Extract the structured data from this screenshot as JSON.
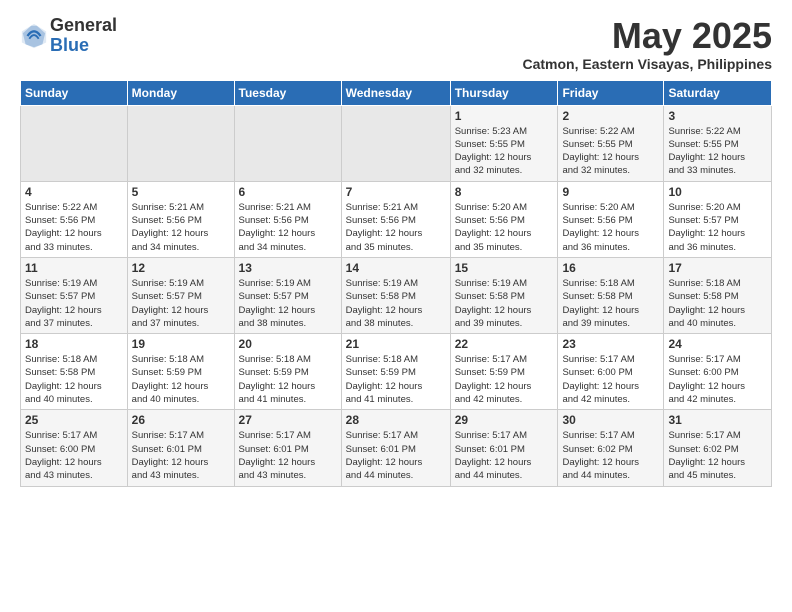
{
  "logo": {
    "general": "General",
    "blue": "Blue"
  },
  "title": "May 2025",
  "location": "Catmon, Eastern Visayas, Philippines",
  "days_of_week": [
    "Sunday",
    "Monday",
    "Tuesday",
    "Wednesday",
    "Thursday",
    "Friday",
    "Saturday"
  ],
  "weeks": [
    [
      {
        "day": "",
        "info": ""
      },
      {
        "day": "",
        "info": ""
      },
      {
        "day": "",
        "info": ""
      },
      {
        "day": "",
        "info": ""
      },
      {
        "day": "1",
        "info": "Sunrise: 5:23 AM\nSunset: 5:55 PM\nDaylight: 12 hours\nand 32 minutes."
      },
      {
        "day": "2",
        "info": "Sunrise: 5:22 AM\nSunset: 5:55 PM\nDaylight: 12 hours\nand 32 minutes."
      },
      {
        "day": "3",
        "info": "Sunrise: 5:22 AM\nSunset: 5:55 PM\nDaylight: 12 hours\nand 33 minutes."
      }
    ],
    [
      {
        "day": "4",
        "info": "Sunrise: 5:22 AM\nSunset: 5:56 PM\nDaylight: 12 hours\nand 33 minutes."
      },
      {
        "day": "5",
        "info": "Sunrise: 5:21 AM\nSunset: 5:56 PM\nDaylight: 12 hours\nand 34 minutes."
      },
      {
        "day": "6",
        "info": "Sunrise: 5:21 AM\nSunset: 5:56 PM\nDaylight: 12 hours\nand 34 minutes."
      },
      {
        "day": "7",
        "info": "Sunrise: 5:21 AM\nSunset: 5:56 PM\nDaylight: 12 hours\nand 35 minutes."
      },
      {
        "day": "8",
        "info": "Sunrise: 5:20 AM\nSunset: 5:56 PM\nDaylight: 12 hours\nand 35 minutes."
      },
      {
        "day": "9",
        "info": "Sunrise: 5:20 AM\nSunset: 5:56 PM\nDaylight: 12 hours\nand 36 minutes."
      },
      {
        "day": "10",
        "info": "Sunrise: 5:20 AM\nSunset: 5:57 PM\nDaylight: 12 hours\nand 36 minutes."
      }
    ],
    [
      {
        "day": "11",
        "info": "Sunrise: 5:19 AM\nSunset: 5:57 PM\nDaylight: 12 hours\nand 37 minutes."
      },
      {
        "day": "12",
        "info": "Sunrise: 5:19 AM\nSunset: 5:57 PM\nDaylight: 12 hours\nand 37 minutes."
      },
      {
        "day": "13",
        "info": "Sunrise: 5:19 AM\nSunset: 5:57 PM\nDaylight: 12 hours\nand 38 minutes."
      },
      {
        "day": "14",
        "info": "Sunrise: 5:19 AM\nSunset: 5:58 PM\nDaylight: 12 hours\nand 38 minutes."
      },
      {
        "day": "15",
        "info": "Sunrise: 5:19 AM\nSunset: 5:58 PM\nDaylight: 12 hours\nand 39 minutes."
      },
      {
        "day": "16",
        "info": "Sunrise: 5:18 AM\nSunset: 5:58 PM\nDaylight: 12 hours\nand 39 minutes."
      },
      {
        "day": "17",
        "info": "Sunrise: 5:18 AM\nSunset: 5:58 PM\nDaylight: 12 hours\nand 40 minutes."
      }
    ],
    [
      {
        "day": "18",
        "info": "Sunrise: 5:18 AM\nSunset: 5:58 PM\nDaylight: 12 hours\nand 40 minutes."
      },
      {
        "day": "19",
        "info": "Sunrise: 5:18 AM\nSunset: 5:59 PM\nDaylight: 12 hours\nand 40 minutes."
      },
      {
        "day": "20",
        "info": "Sunrise: 5:18 AM\nSunset: 5:59 PM\nDaylight: 12 hours\nand 41 minutes."
      },
      {
        "day": "21",
        "info": "Sunrise: 5:18 AM\nSunset: 5:59 PM\nDaylight: 12 hours\nand 41 minutes."
      },
      {
        "day": "22",
        "info": "Sunrise: 5:17 AM\nSunset: 5:59 PM\nDaylight: 12 hours\nand 42 minutes."
      },
      {
        "day": "23",
        "info": "Sunrise: 5:17 AM\nSunset: 6:00 PM\nDaylight: 12 hours\nand 42 minutes."
      },
      {
        "day": "24",
        "info": "Sunrise: 5:17 AM\nSunset: 6:00 PM\nDaylight: 12 hours\nand 42 minutes."
      }
    ],
    [
      {
        "day": "25",
        "info": "Sunrise: 5:17 AM\nSunset: 6:00 PM\nDaylight: 12 hours\nand 43 minutes."
      },
      {
        "day": "26",
        "info": "Sunrise: 5:17 AM\nSunset: 6:01 PM\nDaylight: 12 hours\nand 43 minutes."
      },
      {
        "day": "27",
        "info": "Sunrise: 5:17 AM\nSunset: 6:01 PM\nDaylight: 12 hours\nand 43 minutes."
      },
      {
        "day": "28",
        "info": "Sunrise: 5:17 AM\nSunset: 6:01 PM\nDaylight: 12 hours\nand 44 minutes."
      },
      {
        "day": "29",
        "info": "Sunrise: 5:17 AM\nSunset: 6:01 PM\nDaylight: 12 hours\nand 44 minutes."
      },
      {
        "day": "30",
        "info": "Sunrise: 5:17 AM\nSunset: 6:02 PM\nDaylight: 12 hours\nand 44 minutes."
      },
      {
        "day": "31",
        "info": "Sunrise: 5:17 AM\nSunset: 6:02 PM\nDaylight: 12 hours\nand 45 minutes."
      }
    ]
  ]
}
